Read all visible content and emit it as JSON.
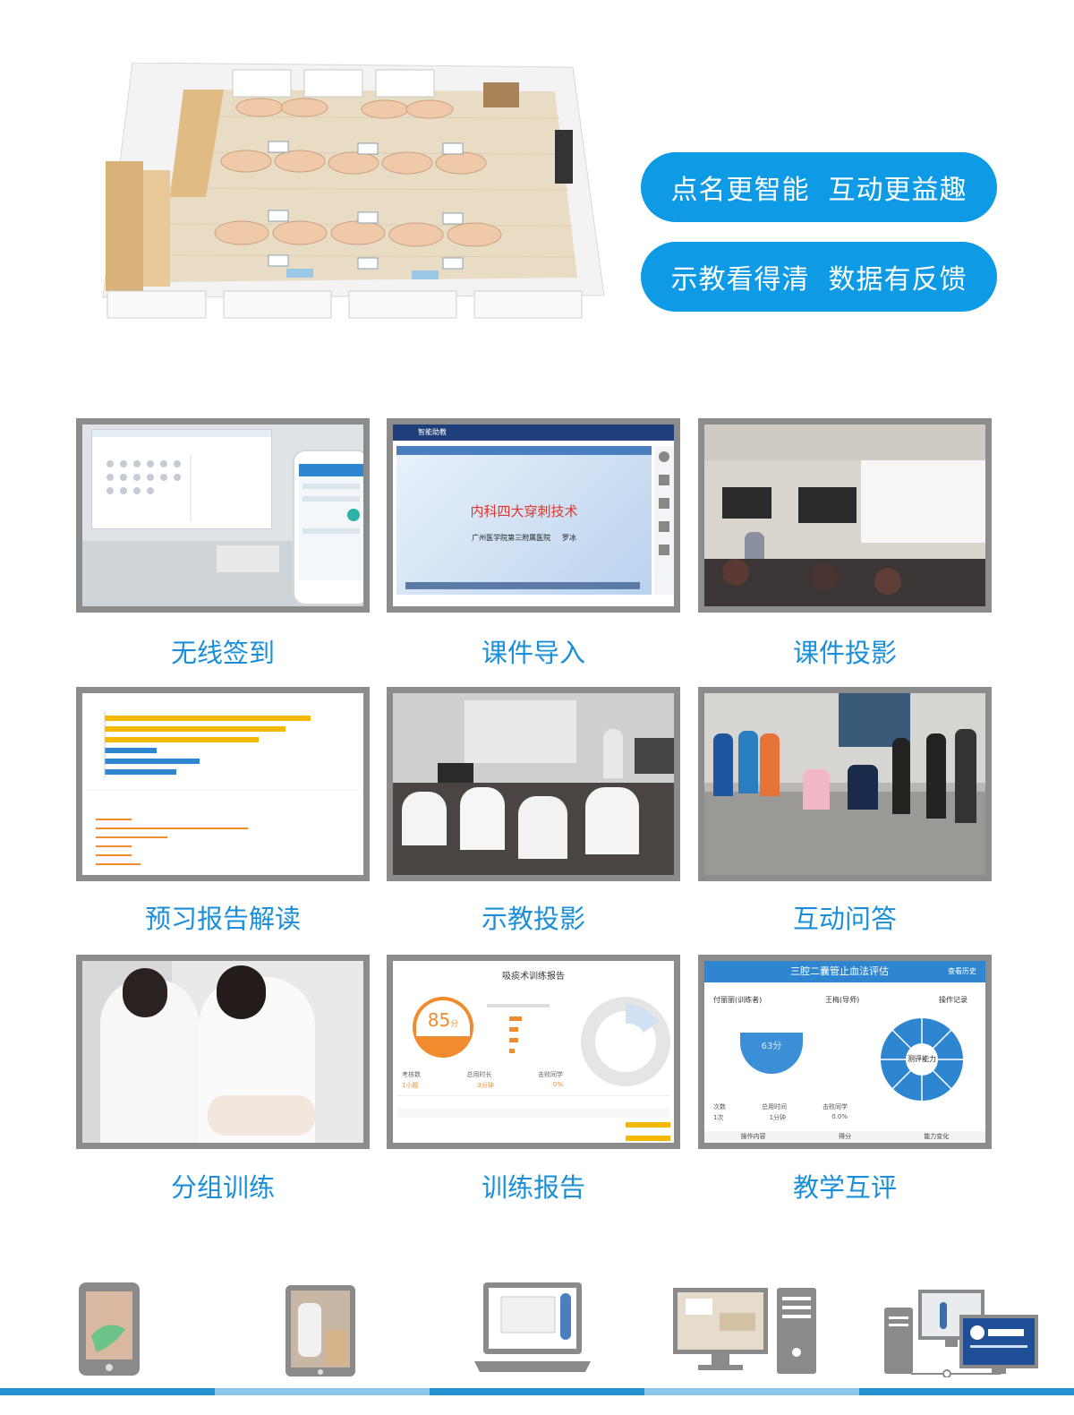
{
  "slogans": [
    "点名更智能  互动更益趣",
    "示教看得清  数据有反馈"
  ],
  "features": [
    {
      "caption": "无线签到"
    },
    {
      "caption": "课件导入"
    },
    {
      "caption": "课件投影"
    },
    {
      "caption": "预习报告解读"
    },
    {
      "caption": "示教投影"
    },
    {
      "caption": "互动问答"
    },
    {
      "caption": "分组训练"
    },
    {
      "caption": "训练报告"
    },
    {
      "caption": "教学互评"
    }
  ],
  "courseware": {
    "app_name": "智能助教",
    "slide_title": "内科四大穿刺技术",
    "slide_subtitle": "广州医学院第三附属医院     罗冰"
  },
  "report": {
    "title": "吸痰术训练报告",
    "score": "85",
    "score_unit": "分",
    "stats_labels": [
      "考核数",
      "总用时长",
      "击败同学"
    ],
    "stats_values": [
      "1小题",
      "3分钟",
      "0%"
    ]
  },
  "eval": {
    "title": "三腔二囊管止血法评估",
    "history": "查看历史",
    "student": "付丽丽(训练者)",
    "teacher": "王梅(导师)",
    "record": "操作记录",
    "score": "63分",
    "center": "测评能力",
    "footer": [
      "操作内容",
      "得分",
      "能力变化"
    ],
    "row_labels": [
      "次数",
      "总用时间",
      "击败同学"
    ],
    "row_values": [
      "1次",
      "1分钟",
      "0.0%"
    ]
  },
  "colors": {
    "accent": "#0f9ae6",
    "caption": "#1a8fd8",
    "frame": "#8c8c8c",
    "bar_orange": "#f5b800",
    "bar_blue": "#2e86d1"
  },
  "devices": [
    "phone-icon",
    "tablet-icon",
    "laptop-icon",
    "desktop-icon",
    "pc-icon"
  ]
}
